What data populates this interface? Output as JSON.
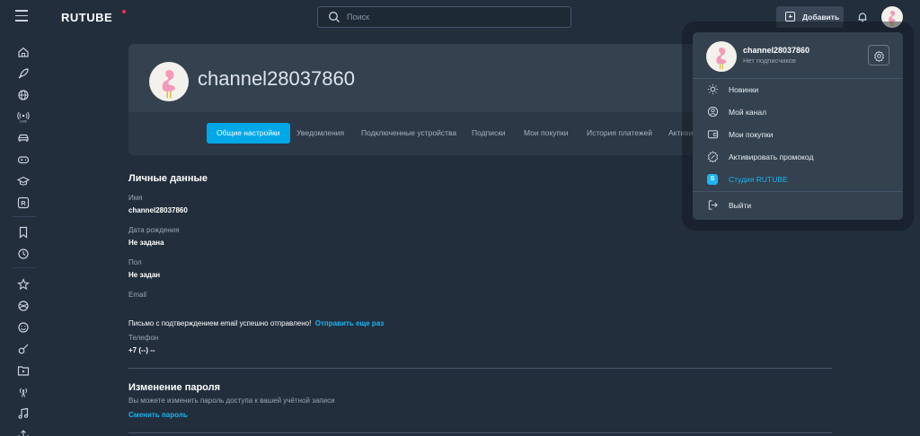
{
  "brand": {
    "logo_text": "RUTUBE",
    "accent": "#00a8e8",
    "dot_color": "#ff2b4f"
  },
  "search": {
    "placeholder": "Поиск",
    "value": ""
  },
  "topbar": {
    "add_label": "Добавить"
  },
  "sidebar": {
    "items": [
      "home-icon",
      "rocket-icon",
      "globe-icon",
      "live-icon",
      "car-icon",
      "gamepad-icon",
      "education-icon",
      "r-badge-icon",
      "bookmark-icon",
      "history-icon",
      "star-icon",
      "planet-icon",
      "smile-icon",
      "guitar-icon",
      "video-folder-icon",
      "broadcast-icon",
      "music-icon",
      "share-icon"
    ]
  },
  "profile": {
    "channel_name": "channel28037860"
  },
  "tabs": [
    {
      "label": "Общие настройки",
      "active": true
    },
    {
      "label": "Уведомления",
      "active": false
    },
    {
      "label": "Подключенные устройства",
      "active": false
    },
    {
      "label": "Подписки",
      "active": false
    },
    {
      "label": "Мои покупки",
      "active": false
    },
    {
      "label": "История платежей",
      "active": false
    },
    {
      "label": "Активи",
      "active": false
    }
  ],
  "personal": {
    "title": "Личные данные",
    "name_label": "Имя",
    "name_value": "channel28037860",
    "birth_label": "Дата рождения",
    "birth_value": "Не задана",
    "gender_label": "Пол",
    "gender_value": "Не задан",
    "email_label": "Email",
    "email_note": "Письмо с подтверждением email успешно отправлено!",
    "email_resend": "Отправить еще раз",
    "phone_label": "Телефон",
    "phone_value": "+7 (--) --"
  },
  "password": {
    "title": "Изменение пароля",
    "description": "Вы можете изменить пароль доступа к вашей учётной записи",
    "change_link": "Сменить пароль"
  },
  "dropdown": {
    "name": "channel28037860",
    "subscribers": "Нет подписчиков",
    "items": [
      {
        "label": "Новинки",
        "icon": "sun-icon"
      },
      {
        "label": "Мой канал",
        "icon": "user-circle-icon"
      },
      {
        "label": "Мои покупки",
        "icon": "wallet-icon"
      },
      {
        "label": "Активировать промокод",
        "icon": "promo-icon"
      },
      {
        "label": "Студия RUTUBE",
        "icon": "studio-icon",
        "badge": "S"
      },
      {
        "label": "Выйти",
        "icon": "logout-icon"
      }
    ]
  }
}
